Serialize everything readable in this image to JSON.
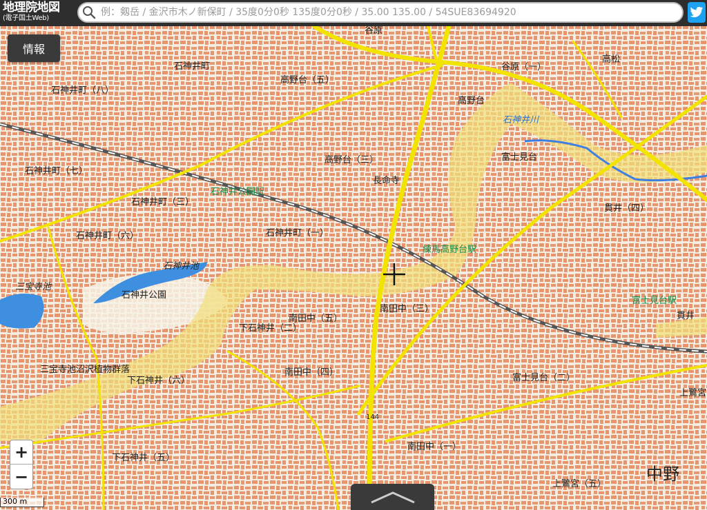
{
  "header": {
    "title": "地理院地図",
    "subtitle": "(電子国土Web)",
    "search_placeholder": "例：剱岳 / 金沢市木ノ新保町 / 35度0分0秒 135度0分0秒 / 35.00 135.00 / 54SUE83694920"
  },
  "controls": {
    "info_label": "情報",
    "zoom_in_label": "+",
    "zoom_out_label": "−",
    "scale_label": "300 m"
  },
  "colors": {
    "header_bg": "#2e2e2e",
    "map_bg": "#f3ede2",
    "building": "#e8946c",
    "road": "#f2e400",
    "flood_zone": "#f1e07a",
    "water": "#3f8fe0",
    "label_green": "#1f8a4c",
    "twitter": "#1da1f2"
  },
  "icons": {
    "search": "magnifier-icon",
    "twitter": "twitter-bird-icon",
    "handle": "chevron-up-icon",
    "crosshair": "crosshair-icon"
  },
  "map": {
    "labels": [
      {
        "text": "谷原",
        "kind": "place"
      },
      {
        "text": "谷原（一）",
        "kind": "place"
      },
      {
        "text": "高松",
        "kind": "place"
      },
      {
        "text": "石神井町（八）",
        "kind": "place"
      },
      {
        "text": "石神井町",
        "kind": "place"
      },
      {
        "text": "高野台（五）",
        "kind": "place"
      },
      {
        "text": "高野台",
        "kind": "place"
      },
      {
        "text": "石神井川",
        "kind": "river"
      },
      {
        "text": "富士見台",
        "kind": "place"
      },
      {
        "text": "石神井町（七）",
        "kind": "place"
      },
      {
        "text": "高野台（三）",
        "kind": "place"
      },
      {
        "text": "長命寺",
        "kind": "place"
      },
      {
        "text": "石神井町（三）",
        "kind": "place"
      },
      {
        "text": "石神井公園駅",
        "kind": "station"
      },
      {
        "text": "貫井（四）",
        "kind": "place"
      },
      {
        "text": "石神井町（六）",
        "kind": "place"
      },
      {
        "text": "石神井町（一）",
        "kind": "place"
      },
      {
        "text": "練馬高野台駅",
        "kind": "station"
      },
      {
        "text": "石神井池",
        "kind": "pond"
      },
      {
        "text": "三宝寺池",
        "kind": "pond"
      },
      {
        "text": "石神井公園",
        "kind": "place"
      },
      {
        "text": "南田中（三）",
        "kind": "place"
      },
      {
        "text": "富士見台駅",
        "kind": "station"
      },
      {
        "text": "貫井",
        "kind": "place"
      },
      {
        "text": "南田中（五）",
        "kind": "place"
      },
      {
        "text": "下石神井（二）",
        "kind": "place"
      },
      {
        "text": "南田中（四）",
        "kind": "place"
      },
      {
        "text": "下石神井（六）",
        "kind": "place"
      },
      {
        "text": "富士見台（二）",
        "kind": "place"
      },
      {
        "text": "三宝寺池沼沢植物群落",
        "kind": "place"
      },
      {
        "text": "上鷺宮",
        "kind": "place"
      },
      {
        "text": "南田中（一）",
        "kind": "place"
      },
      {
        "text": "下石神井（五）",
        "kind": "place"
      },
      {
        "text": "中野",
        "kind": "ward"
      },
      {
        "text": "上鷺宮（五）",
        "kind": "place"
      },
      {
        "text": "144",
        "kind": "elevation"
      }
    ]
  }
}
